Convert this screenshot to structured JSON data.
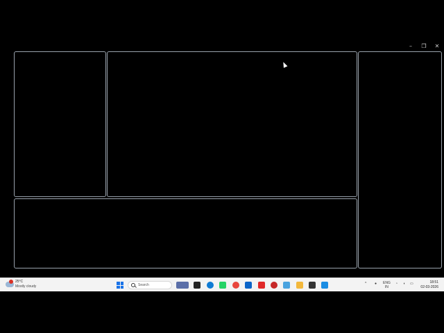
{
  "window_controls": {
    "minimize_glyph": "–",
    "restore_glyph": "❐",
    "close_glyph": "✕"
  },
  "taskbar": {
    "weather": {
      "temp": "25°C",
      "condition": "Mostly cloudy",
      "icon": "cloud-icon"
    },
    "search": {
      "label": "Search"
    },
    "apps": [
      {
        "name": "widget-app",
        "color": "#5b6fa8"
      },
      {
        "name": "task-view",
        "color": "#222222"
      },
      {
        "name": "edge",
        "color": "#0f7bd4"
      },
      {
        "name": "whatsapp",
        "color": "#25d366"
      },
      {
        "name": "chrome",
        "color": "#e8453c"
      },
      {
        "name": "outlook",
        "color": "#0a64c8"
      },
      {
        "name": "acrobat",
        "color": "#e02828"
      },
      {
        "name": "app-red",
        "color": "#c62828"
      },
      {
        "name": "notepad",
        "color": "#4aa3df"
      },
      {
        "name": "file-explorer",
        "color": "#f3b83c"
      },
      {
        "name": "terminal",
        "color": "#333333"
      },
      {
        "name": "vscode",
        "color": "#1b8de3"
      }
    ],
    "tray": {
      "language": "ENG",
      "region": "IN"
    },
    "clock": {
      "time": "18:51",
      "date": "02-03-2026"
    }
  }
}
